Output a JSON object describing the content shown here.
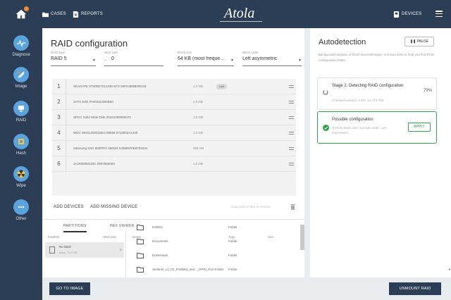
{
  "topbar": {
    "cases_label": "CASES",
    "reports_label": "REPORTS",
    "brand": "Atola",
    "devices_label": "DEVICES"
  },
  "sidebar": {
    "items": [
      {
        "label": "Diagnose",
        "icon": "pulse-icon"
      },
      {
        "label": "Image",
        "icon": "image-icon"
      },
      {
        "label": "RAID",
        "icon": "raid-icon"
      },
      {
        "label": "Hash",
        "icon": "hash-icon"
      },
      {
        "label": "Wipe",
        "icon": "radiation-icon"
      },
      {
        "label": "Other",
        "icon": "more-icon"
      }
    ]
  },
  "raid": {
    "title": "RAID configuration",
    "fields": [
      {
        "label": "RAID type",
        "value": "RAID 5"
      },
      {
        "label": "Start LBA",
        "value": "0"
      },
      {
        "label": "Block size",
        "value": "64 KB (most freque..."
      },
      {
        "label": "Block order",
        "value": "Left asymmetric"
      }
    ],
    "devices": [
      {
        "num": "1",
        "name": "SEAGATE ST4000TS11235 NT3 S6FH4B0B0W134",
        "size": "1.0 GB",
        "badge": "Unk"
      },
      {
        "num": "2",
        "name": "SATA SSD PHI0311GB0B00",
        "size": "1.0 GB",
        "badge": ""
      },
      {
        "num": "3",
        "name": "SPCC Solid State Disk 20161009050070",
        "size": "1.0 GB",
        "badge": ""
      },
      {
        "num": "4",
        "name": "WDC WD0120001DE3 08558 5710003A1440",
        "size": "1.0 GB",
        "badge": ""
      },
      {
        "num": "5",
        "name": "Samsung SSD 860PRO 256GB S45MNF0K870343A",
        "size": "256 GB",
        "badge": ""
      },
      {
        "num": "6",
        "name": "JAJS500M120C 0907894003",
        "size": "1.0 GB",
        "badge": ""
      }
    ],
    "add_devices": "ADD DEVICES",
    "add_missing": "ADD MISSING DEVICE",
    "drag_hint": "Drag device here to remove"
  },
  "bottom": {
    "tab_partitions": "PARTITIONS",
    "tab_hex": "HEX VIEWER",
    "partition_header": "Partition",
    "start_lba_header": "Start LBA",
    "partition": {
      "name": "No label",
      "sub": "exfat, 71.3 GB",
      "start": "0"
    },
    "file_headers": {
      "name": "Name",
      "type": "Type",
      "size": "Size"
    },
    "files": [
      {
        "name": "testfiles",
        "type": "Folder"
      },
      {
        "name": "Documents",
        "type": "Folder"
      },
      {
        "name": "Downloads",
        "type": "Folder"
      },
      {
        "name": "Sentinel_L1_04_FindMat_and..._RPW_Run.Folder",
        "type": "Folder"
      }
    ]
  },
  "autodetect": {
    "title": "Autodetection",
    "pause_label": "PAUSE",
    "description": "Background analysis of RAID devices/images. It shows hints to help you find RAID configuration faster.",
    "stage_title": "Stage 2. Detecting RAID configuration",
    "stage_sub": "Checked variants: 6,537 out of 6,760",
    "stage_pct": "79%",
    "possible_title": "Possible configuration",
    "possible_sub": "RAID 5, block size: 512 KB, order: Left asymmetric",
    "apply_label": "APPLY"
  },
  "buttons": {
    "go_to_image": "GO TO IMAGE",
    "unmount": "UNMOUNT RAID"
  },
  "colors": {
    "nav": "#2c3e55",
    "accent": "#5aa3dd",
    "success": "#2ea24a",
    "notification": "#f08a2c"
  }
}
